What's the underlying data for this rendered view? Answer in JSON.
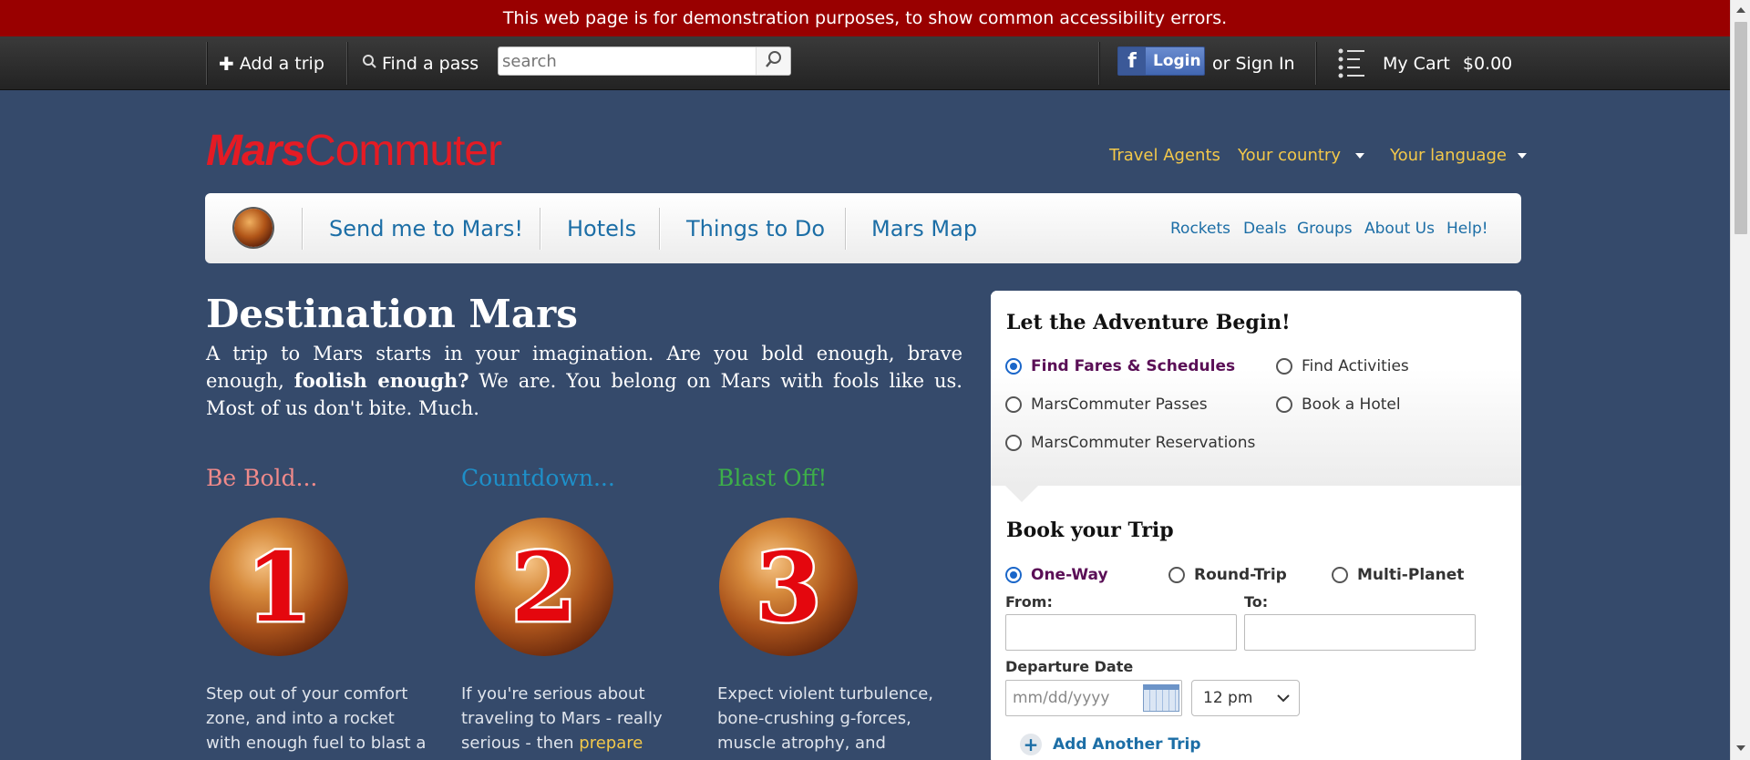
{
  "banner": {
    "text": "This web page is for demonstration purposes, to show common accessibility errors."
  },
  "topbar": {
    "add_trip": "Add a trip",
    "find_pass": "Find a pass",
    "search_placeholder": "search",
    "login": "Login",
    "sign_in": "or Sign In",
    "cart_label": "My Cart",
    "cart_total": "$0.00"
  },
  "header": {
    "logo_mars": "Mars",
    "logo_commuter": "Commuter",
    "links": [
      "Travel Agents",
      "Your country",
      "Your language"
    ]
  },
  "nav": {
    "main": [
      "Send me to Mars!",
      "Hotels",
      "Things to Do",
      "Mars Map"
    ],
    "secondary": [
      "Rockets",
      "Deals",
      "Groups",
      "About Us",
      "Help!"
    ]
  },
  "main": {
    "title": "Destination Mars",
    "intro_1": "A trip to Mars starts in your imagination. Are you bold enough, brave enough, ",
    "intro_bold": "foolish enough?",
    "intro_2": " We are. You belong on Mars with fools like us. Most of us don't bite. Much.",
    "steps": [
      {
        "heading": "Be Bold...",
        "color": "#f08a8a",
        "number": "1",
        "text": "Step out of your comfort zone, and into a rocket with enough fuel to blast a",
        "link": ""
      },
      {
        "heading": "Countdown...",
        "color": "#1e8fc8",
        "number": "2",
        "text": "If you're serious about traveling to Mars - really serious - then ",
        "link": "prepare"
      },
      {
        "heading": "Blast Off!",
        "color": "#3daf49",
        "number": "3",
        "text": "Expect violent turbulence, bone-crushing g-forces, muscle atrophy, and",
        "link": ""
      }
    ]
  },
  "panel": {
    "adventure_title": "Let the Adventure Begin!",
    "search_types": [
      {
        "label": "Find Fares & Schedules",
        "selected": true
      },
      {
        "label": "Find Activities",
        "selected": false
      },
      {
        "label": "MarsCommuter Passes",
        "selected": false
      },
      {
        "label": "Book a Hotel",
        "selected": false
      },
      {
        "label": "MarsCommuter Reservations",
        "selected": false
      }
    ],
    "book_title": "Book your Trip",
    "trip_types": [
      {
        "label": "One-Way",
        "selected": true
      },
      {
        "label": "Round-Trip",
        "selected": false
      },
      {
        "label": "Multi-Planet",
        "selected": false
      }
    ],
    "from_label": "From:",
    "to_label": "To:",
    "departure_label": "Departure Date",
    "date_placeholder": "mm/dd/yyyy",
    "time_value": "12 pm",
    "add_another": "Add Another Trip"
  },
  "colors": {
    "background": "#354a6b",
    "banner": "#990000",
    "accent_link": "#1c6ea6",
    "header_link": "#f3c84a",
    "logo": "#e51b24"
  }
}
